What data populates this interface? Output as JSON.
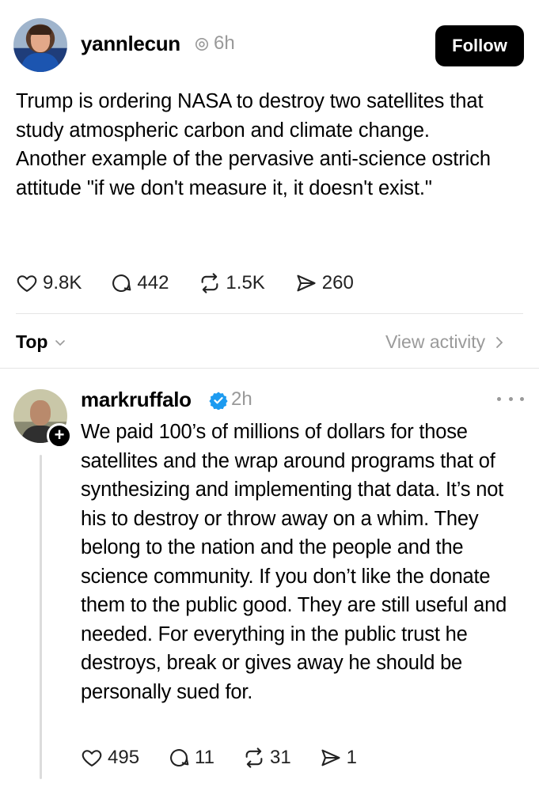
{
  "post": {
    "username": "yannlecun",
    "time": "6h",
    "follow_label": "Follow",
    "paragraphs": [
      "Trump is ordering NASA to destroy two satellites that study atmospheric carbon and climate change.",
      "Another example of the pervasive anti-science ostrich attitude \"if we don't measure it, it doesn't exist.\""
    ],
    "likes": "9.8K",
    "replies": "442",
    "reposts": "1.5K",
    "shares": "260"
  },
  "activity_bar": {
    "sort_label": "Top",
    "view_activity_label": "View activity"
  },
  "reply": {
    "username": "markruffalo",
    "time": "2h",
    "text": "We paid 100’s of millions of dollars for those satellites and the wrap around programs that of synthesizing and implementing that data. It’s not his to destroy or throw away on a whim. They belong to the nation and the people and the science community. If you don’t like the donate them to the public good. They are still useful and needed.  For everything in the public trust he destroys, break or gives away he should be personally sued for.",
    "likes": "495",
    "replies": "11",
    "reposts": "31",
    "shares": "1"
  },
  "icons": {
    "like": "heart-icon",
    "reply": "comment-icon",
    "repost": "repost-icon",
    "share": "send-icon",
    "verified": "verified-badge-icon",
    "threads": "threads-icon"
  },
  "colors": {
    "verified_blue": "#1d9bf0",
    "muted_text": "#999999",
    "follow_bg": "#000000"
  }
}
